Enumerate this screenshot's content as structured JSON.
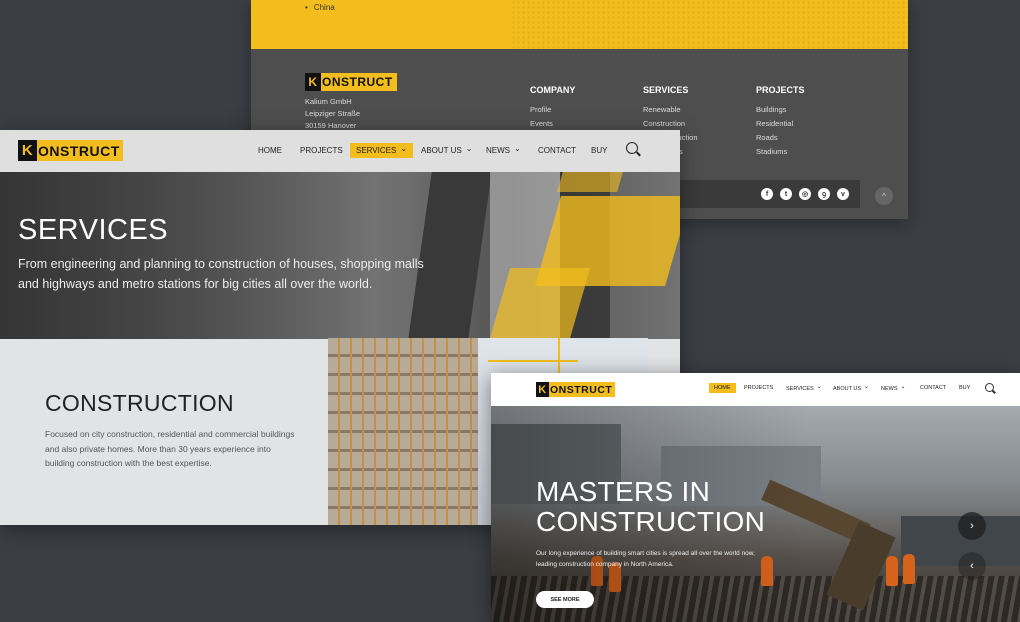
{
  "back": {
    "china": "China",
    "logo_k": "K",
    "logo_text": "ONSTRUCT",
    "address": [
      "Kalium GmbH",
      "Leipziger Straße",
      "30159 Hanover"
    ],
    "columns": [
      {
        "heading": "COMPANY",
        "items": [
          "Profile",
          "Events"
        ]
      },
      {
        "heading": "SERVICES",
        "items": [
          "Renewable",
          "Construction",
          "nstruction",
          "s"
        ]
      },
      {
        "heading": "PROJECTS",
        "items": [
          "Buildings",
          "Residential",
          "Roads",
          "Stadiums"
        ]
      }
    ],
    "social": [
      "f",
      "t",
      "◎",
      "ꝯ",
      "v"
    ],
    "totop": "^"
  },
  "mid": {
    "logo_k": "K",
    "logo_text": "ONSTRUCT",
    "nav": {
      "home": "HOME",
      "projects": "PROJECTS",
      "services": "SERVICES",
      "about": "ABOUT US",
      "news": "NEWS",
      "contact": "CONTACT",
      "buy": "BUY"
    },
    "hero_title": "SERVICES",
    "hero_desc": "From engineering and planning to construction of houses, shopping malls and highways and metro stations for big cities all over the world.",
    "section_title": "CONSTRUCTION",
    "section_desc": "Focused on city construction, residential and commercial buildings and also private homes. More than 30 years experience into building construction with the best expertise."
  },
  "front": {
    "logo_k": "K",
    "logo_text": "ONSTRUCT",
    "nav": {
      "home": "HOME",
      "projects": "PROJECTS",
      "services": "SERVICES",
      "about": "ABOUT US",
      "news": "NEWS",
      "contact": "CONTACT",
      "buy": "BUY"
    },
    "hero_title_1": "MASTERS IN",
    "hero_title_2": "CONSTRUCTION",
    "hero_desc": "Our long experience of building smart cities is spread all over the world now, leading construction company in North America.",
    "cta": "SEE MORE",
    "next": "›",
    "prev": "‹"
  },
  "colors": {
    "accent": "#f2bd1d",
    "dark": "#3b3f44",
    "footer": "#4e4e4e"
  }
}
